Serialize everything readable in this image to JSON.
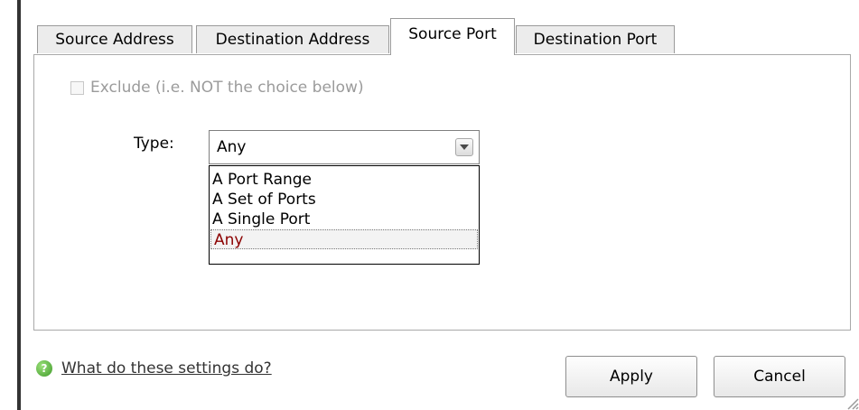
{
  "tabs": [
    {
      "label": "Source Address"
    },
    {
      "label": "Destination Address"
    },
    {
      "label": "Source Port"
    },
    {
      "label": "Destination Port"
    }
  ],
  "active_tab": "Source Port",
  "exclude": {
    "label": "Exclude (i.e. NOT the choice below)",
    "checked": false,
    "enabled": false
  },
  "type": {
    "label": "Type:",
    "selected": "Any",
    "options": [
      {
        "label": "A Port Range"
      },
      {
        "label": "A Set of Ports"
      },
      {
        "label": "A Single Port"
      },
      {
        "label": "Any"
      }
    ]
  },
  "help": {
    "link_text": "What do these settings do?"
  },
  "buttons": {
    "apply": "Apply",
    "cancel": "Cancel"
  }
}
